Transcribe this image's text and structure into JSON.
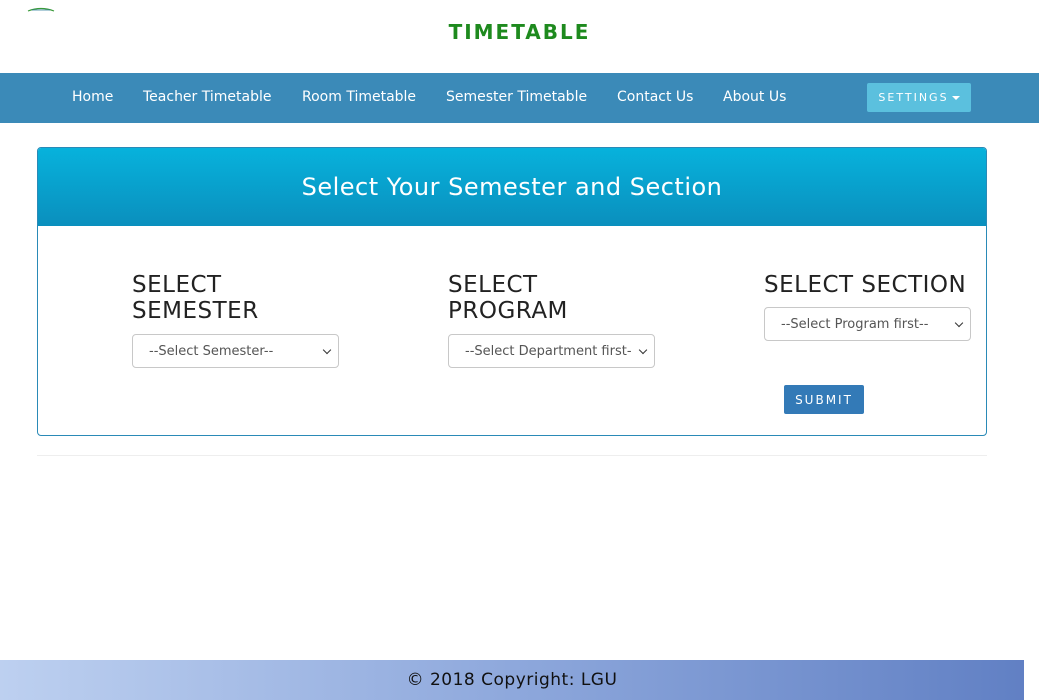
{
  "header": {
    "title": "TIMETABLE",
    "logo": "lgu-logo"
  },
  "nav": {
    "items": [
      {
        "label": "Home"
      },
      {
        "label": "Teacher Timetable"
      },
      {
        "label": "Room Timetable"
      },
      {
        "label": "Semester Timetable"
      },
      {
        "label": "Contact Us"
      },
      {
        "label": "About Us"
      }
    ],
    "settings_label": "SETTINGS"
  },
  "panel": {
    "title": "Select Your Semester and Section",
    "semester": {
      "label_line1": "SELECT",
      "label_line2": "SEMESTER",
      "selected": "--Select Semester--"
    },
    "program": {
      "label_line1": "SELECT",
      "label_line2": "PROGRAM",
      "selected": "--Select Department first--"
    },
    "section": {
      "label": "SELECT SECTION",
      "selected": "--Select Program first--"
    },
    "submit_label": "SUBMIT"
  },
  "footer": {
    "text": "© 2018 Copyright: LGU"
  },
  "colors": {
    "title_green": "#1e8a1e",
    "navbar": "#3b8ab8",
    "settings_button": "#5bc0de",
    "panel_heading": "#07b2dc",
    "submit_button": "#337ab7"
  }
}
